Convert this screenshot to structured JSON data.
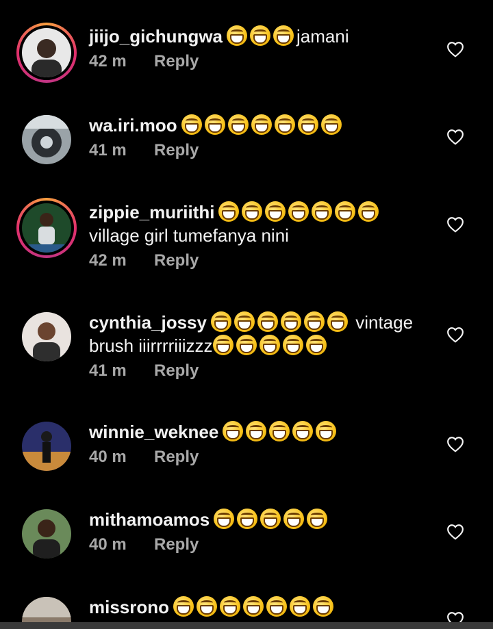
{
  "comments": [
    {
      "username": "jiijo_gichungwa",
      "emoji_count": 3,
      "text_after": "jamani",
      "line2": "",
      "time": "42 m",
      "reply": "Reply"
    },
    {
      "username": "wa.iri.moo",
      "emoji_count": 7,
      "text_after": "",
      "line2": "",
      "time": "41 m",
      "reply": "Reply"
    },
    {
      "username": "zippie_muriithi",
      "emoji_count": 7,
      "text_after": "",
      "line2": "village girl tumefanya nini",
      "time": "42 m",
      "reply": "Reply"
    },
    {
      "username": "cynthia_jossy",
      "emoji_count": 6,
      "text_after": " vintage",
      "line2": "brush iiirrrriiizzz",
      "line2_emoji_count": 5,
      "time": "41 m",
      "reply": "Reply"
    },
    {
      "username": "winnie_weknee",
      "emoji_count": 5,
      "text_after": "",
      "line2": "",
      "time": "40 m",
      "reply": "Reply"
    },
    {
      "username": "mithamoamos",
      "emoji_count": 5,
      "text_after": "",
      "line2": "",
      "time": "40 m",
      "reply": "Reply"
    },
    {
      "username": "missrono",
      "emoji_count": 7,
      "text_after": "",
      "line2": "",
      "time": "",
      "reply": ""
    }
  ],
  "icons": {
    "emoji": "face-with-tears-of-joy",
    "like": "heart-outline-icon"
  },
  "colors": {
    "background": "#000000",
    "text": "#f2f2f2",
    "meta": "#a8a8a8",
    "story_ring_start": "#f9a03f",
    "story_ring_end": "#c13584"
  }
}
